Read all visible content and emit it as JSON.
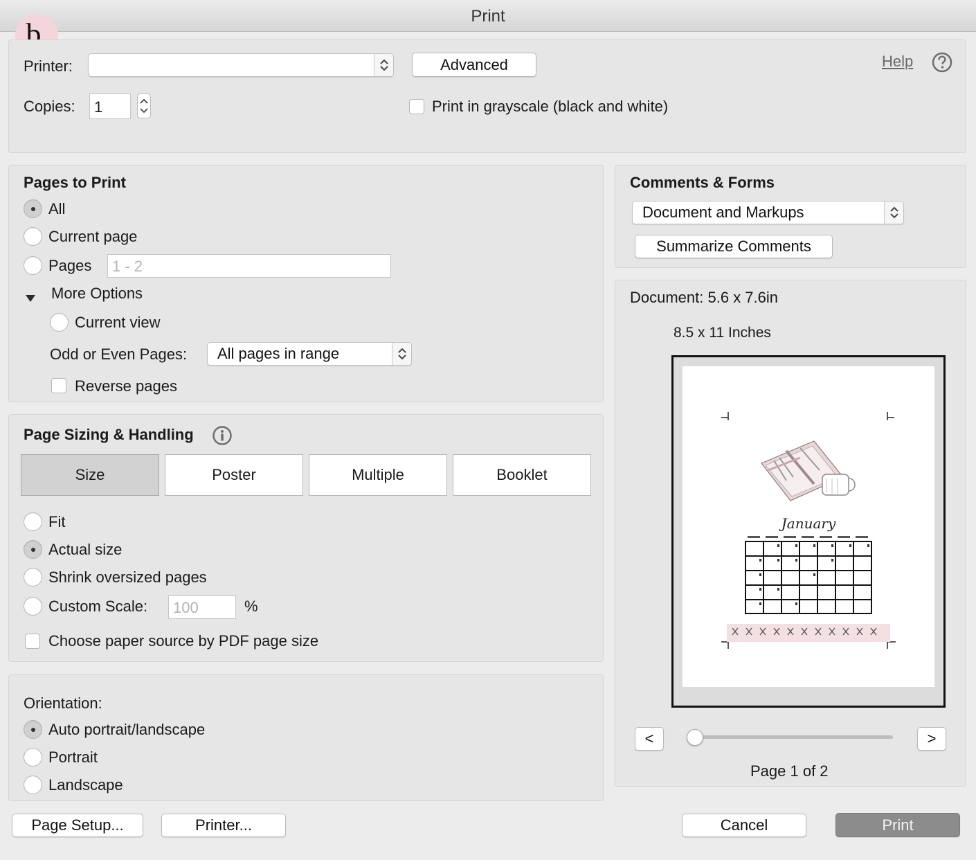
{
  "window": {
    "title": "Print"
  },
  "badge": {
    "text": "b."
  },
  "top": {
    "printer_label": "Printer:",
    "printer_value": "",
    "advanced_label": "Advanced",
    "help_label": "Help",
    "copies_label": "Copies:",
    "copies_value": "1",
    "grayscale_label": "Print in grayscale (black and white)",
    "grayscale_checked": false
  },
  "pages_to_print": {
    "title": "Pages to Print",
    "options": [
      {
        "label": "All",
        "selected": true
      },
      {
        "label": "Current page",
        "selected": false
      },
      {
        "label": "Pages",
        "selected": false
      }
    ],
    "pages_range_placeholder": "1 - 2",
    "more_options_label": "More Options",
    "current_view_label": "Current view",
    "odd_even_label": "Odd or Even Pages:",
    "odd_even_value": "All pages in range",
    "reverse_label": "Reverse pages",
    "reverse_checked": false
  },
  "sizing": {
    "title": "Page Sizing & Handling",
    "tabs": [
      "Size",
      "Poster",
      "Multiple",
      "Booklet"
    ],
    "active_tab": "Size",
    "options": [
      {
        "label": "Fit",
        "selected": false
      },
      {
        "label": "Actual size",
        "selected": true
      },
      {
        "label": "Shrink oversized pages",
        "selected": false
      },
      {
        "label": "Custom Scale:",
        "selected": false
      }
    ],
    "custom_scale_placeholder": "100",
    "percent_label": "%",
    "paper_source_label": "Choose paper source by PDF page size",
    "paper_source_checked": false
  },
  "orientation": {
    "title": "Orientation:",
    "options": [
      {
        "label": "Auto portrait/landscape",
        "selected": true
      },
      {
        "label": "Portrait",
        "selected": false
      },
      {
        "label": "Landscape",
        "selected": false
      }
    ]
  },
  "comments_forms": {
    "title": "Comments & Forms",
    "value": "Document and Markups",
    "summarize_label": "Summarize Comments"
  },
  "preview": {
    "document_size": "Document: 5.6 x 7.6in",
    "paper_size": "8.5 x 11 Inches",
    "month_title": "January",
    "prev_label": "<",
    "next_label": ">",
    "page_indicator": "Page 1 of 2",
    "page_slider_position": 0
  },
  "footer": {
    "page_setup_label": "Page Setup...",
    "printer_label": "Printer...",
    "cancel_label": "Cancel",
    "print_label": "Print"
  },
  "colors": {
    "window_bg": "#ececec",
    "panel_bg": "#e6e6e6",
    "badge_bg": "#f3d5db",
    "print_button_bg": "#8c8c8c",
    "washi_tape": "#f4dfe2"
  }
}
